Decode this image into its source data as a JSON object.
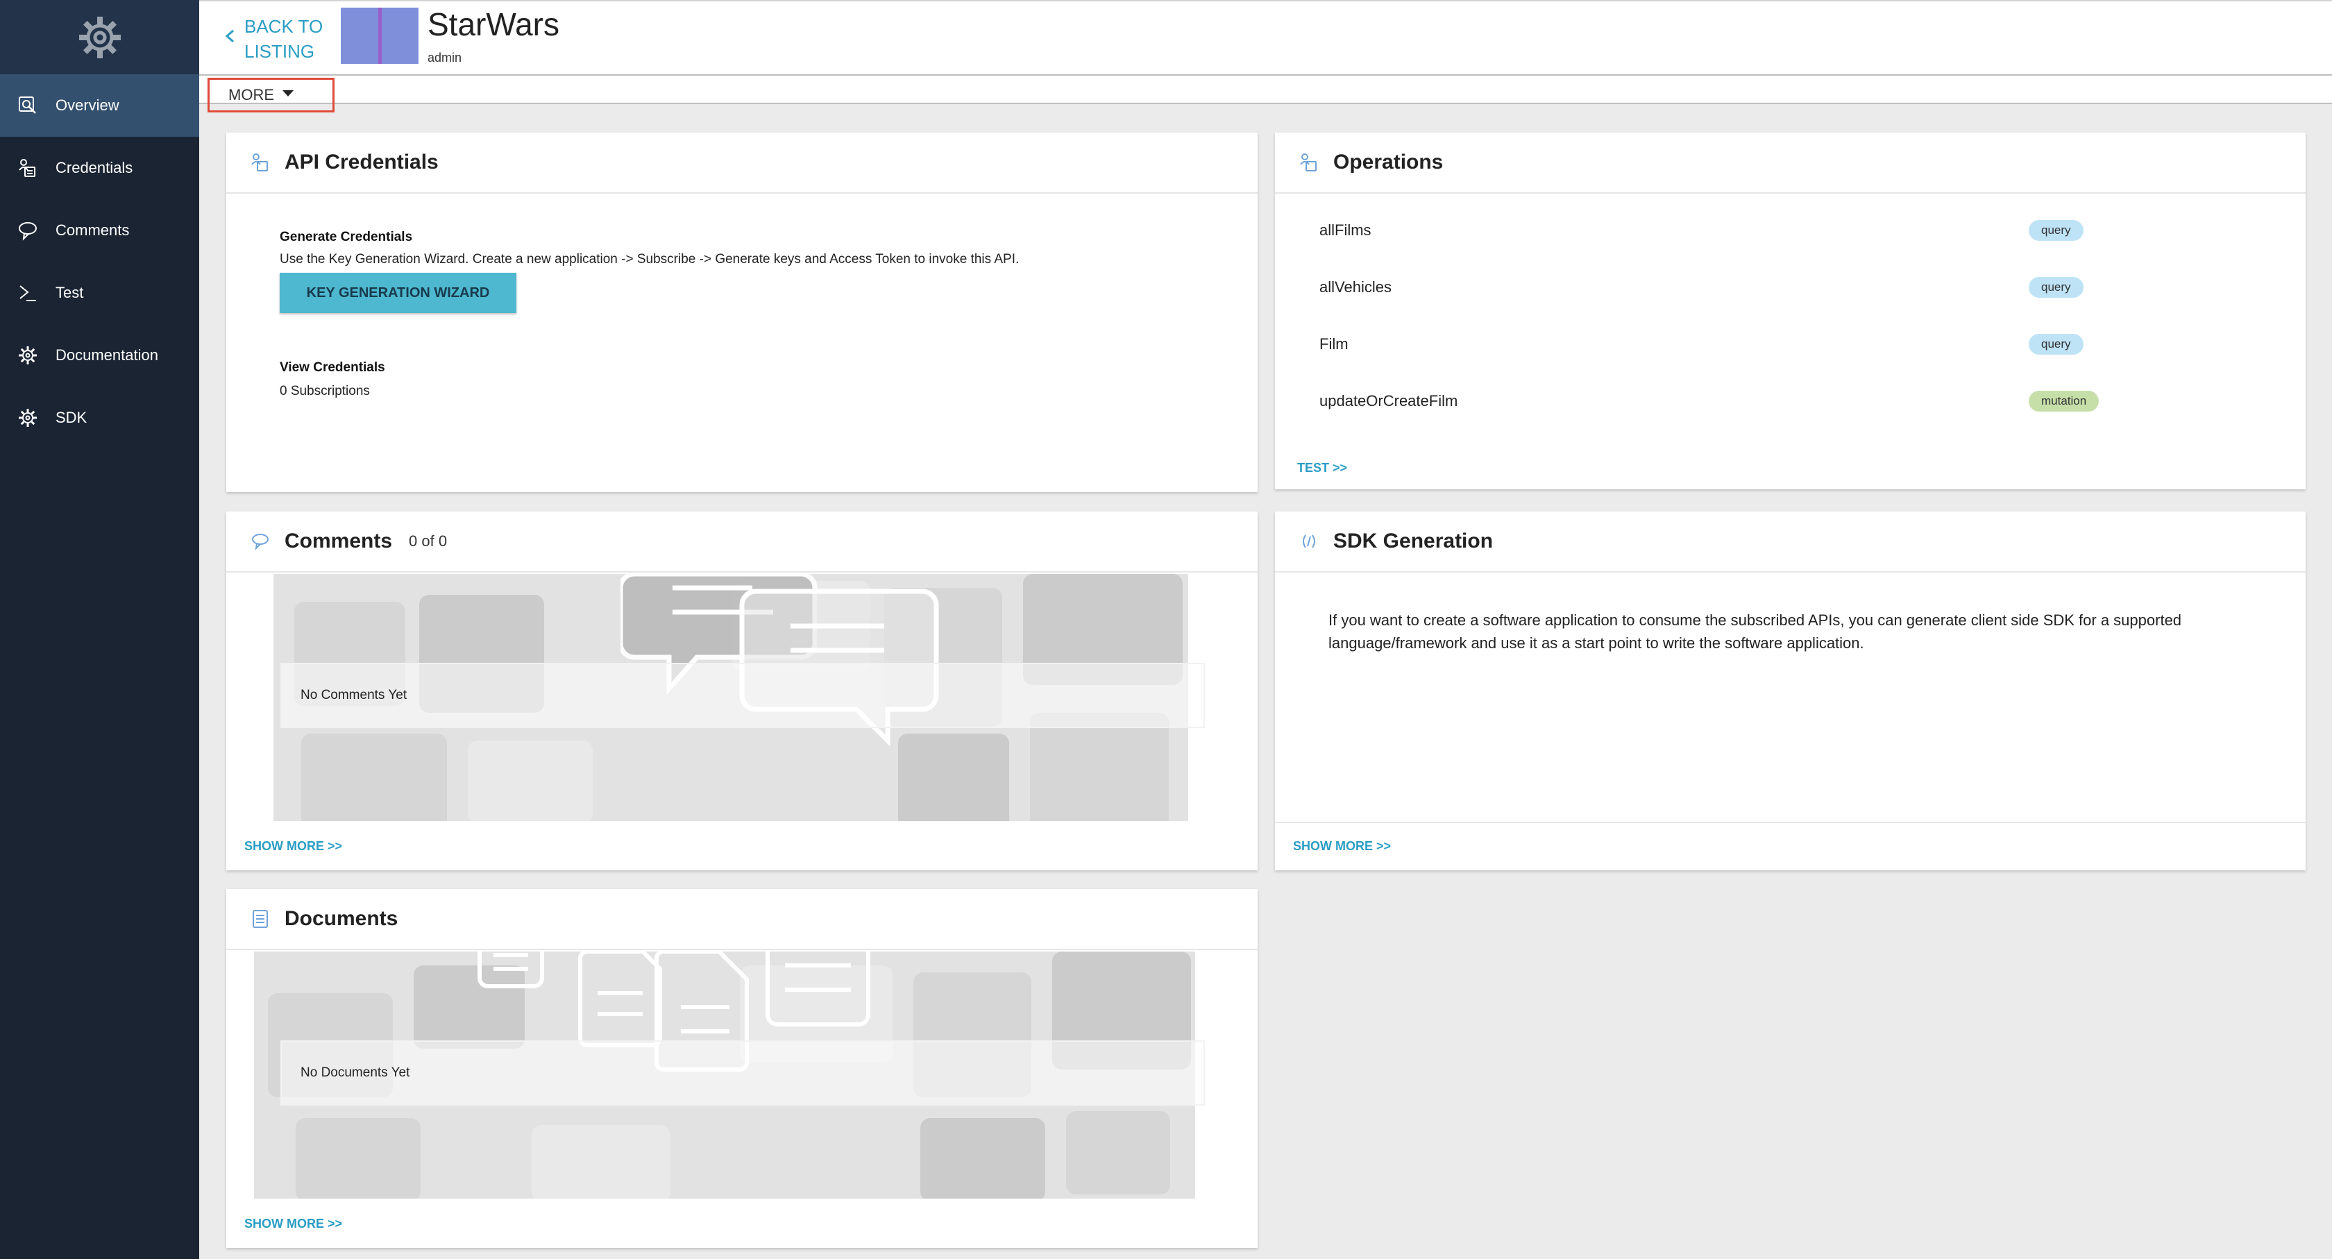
{
  "sidebar": {
    "items": [
      {
        "label": "Overview",
        "icon": "overview-icon",
        "active": true
      },
      {
        "label": "Credentials",
        "icon": "credentials-icon",
        "active": false
      },
      {
        "label": "Comments",
        "icon": "comments-icon",
        "active": false
      },
      {
        "label": "Test",
        "icon": "terminal-icon",
        "active": false
      },
      {
        "label": "Documentation",
        "icon": "gear-icon",
        "active": false
      },
      {
        "label": "SDK",
        "icon": "gear-icon",
        "active": false
      }
    ]
  },
  "header": {
    "back_line1": "BACK TO",
    "back_line2": "LISTING",
    "api_name": "StarWars",
    "owner": "admin"
  },
  "more_menu": {
    "label": "MORE"
  },
  "api_credentials": {
    "title": "API Credentials",
    "generate_title": "Generate Credentials",
    "generate_desc": "Use the Key Generation Wizard. Create a new application -> Subscribe -> Generate keys and Access Token to invoke this API.",
    "wizard_button": "KEY GENERATION WIZARD",
    "view_title": "View Credentials",
    "subscriptions": "0 Subscriptions"
  },
  "operations": {
    "title": "Operations",
    "items": [
      {
        "name": "allFilms",
        "type": "query"
      },
      {
        "name": "allVehicles",
        "type": "query"
      },
      {
        "name": "Film",
        "type": "query"
      },
      {
        "name": "updateOrCreateFilm",
        "type": "mutation"
      }
    ],
    "test_link": "TEST >>"
  },
  "comments": {
    "title": "Comments",
    "count": "0 of 0",
    "empty": "No Comments Yet",
    "show_more": "SHOW MORE >>"
  },
  "sdk": {
    "title": "SDK Generation",
    "text": "If you want to create a software application to consume the subscribed APIs, you can generate client side SDK for a supported language/framework and use it as a start point to write the software application.",
    "show_more": "SHOW MORE >>"
  },
  "documents": {
    "title": "Documents",
    "empty": "No Documents Yet",
    "show_more": "SHOW MORE >>"
  },
  "colors": {
    "sidebar_bg": "#1a2433",
    "sidebar_active": "#34506f",
    "accent": "#2a9dc4",
    "wizard_button": "#4db8cf",
    "badge_query": "#bfe3f6",
    "badge_mutation": "#c6dfa9",
    "highlight_box": "#e04a3a"
  }
}
